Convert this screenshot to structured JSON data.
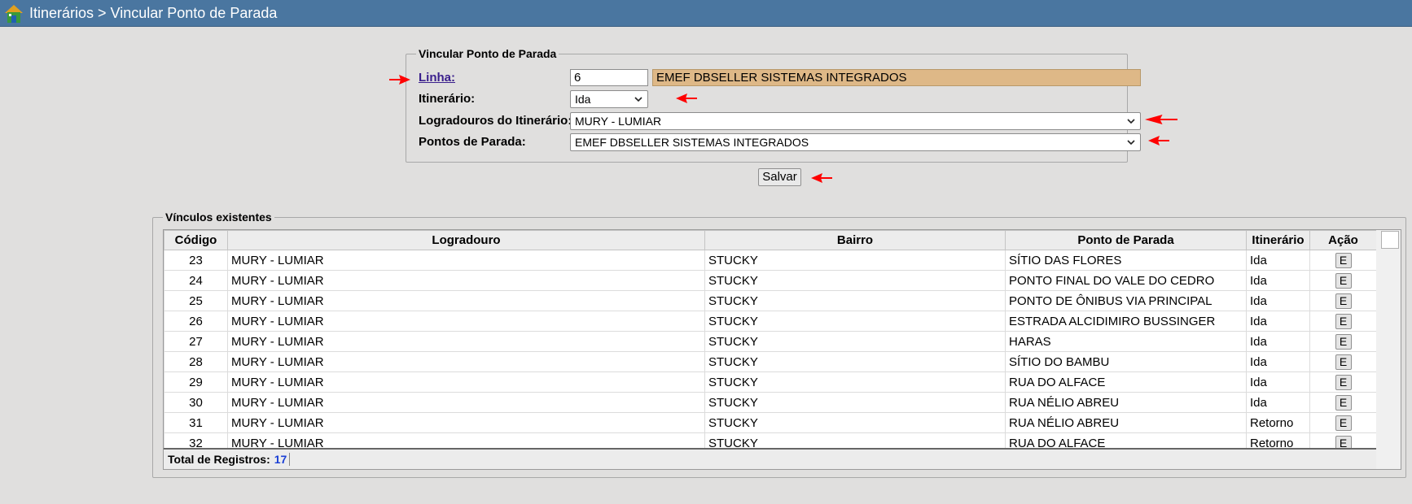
{
  "header": {
    "breadcrumb": "Itinerários > Vincular Ponto de Parada"
  },
  "form": {
    "legend": "Vincular Ponto de Parada",
    "linha_label": "Linha:",
    "linha_value": "6",
    "linha_description": "EMEF DBSELLER SISTEMAS INTEGRADOS",
    "itinerario_label": "Itinerário:",
    "itinerario_value": "Ida",
    "logradouros_label": "Logradouros do Itinerário:",
    "logradouros_value": "MURY - LUMIAR",
    "pontos_label": "Pontos de Parada:",
    "pontos_value": "EMEF DBSELLER SISTEMAS INTEGRADOS",
    "save_label": "Salvar"
  },
  "links": {
    "legend": "Vínculos existentes",
    "columns": [
      "Código",
      "Logradouro",
      "Bairro",
      "Ponto de Parada",
      "Itinerário",
      "Ação"
    ],
    "rows": [
      {
        "codigo": "23",
        "logradouro": "MURY - LUMIAR",
        "bairro": "STUCKY",
        "ponto": "SÍTIO DAS FLORES",
        "itinerario": "Ida",
        "acao": "E"
      },
      {
        "codigo": "24",
        "logradouro": "MURY - LUMIAR",
        "bairro": "STUCKY",
        "ponto": "PONTO FINAL DO VALE DO CEDRO",
        "itinerario": "Ida",
        "acao": "E"
      },
      {
        "codigo": "25",
        "logradouro": "MURY - LUMIAR",
        "bairro": "STUCKY",
        "ponto": "PONTO DE ÔNIBUS VIA PRINCIPAL",
        "itinerario": "Ida",
        "acao": "E"
      },
      {
        "codigo": "26",
        "logradouro": "MURY - LUMIAR",
        "bairro": "STUCKY",
        "ponto": "ESTRADA ALCIDIMIRO BUSSINGER",
        "itinerario": "Ida",
        "acao": "E"
      },
      {
        "codigo": "27",
        "logradouro": "MURY - LUMIAR",
        "bairro": "STUCKY",
        "ponto": "HARAS",
        "itinerario": "Ida",
        "acao": "E"
      },
      {
        "codigo": "28",
        "logradouro": "MURY - LUMIAR",
        "bairro": "STUCKY",
        "ponto": "SÍTIO DO BAMBU",
        "itinerario": "Ida",
        "acao": "E"
      },
      {
        "codigo": "29",
        "logradouro": "MURY - LUMIAR",
        "bairro": "STUCKY",
        "ponto": "RUA DO ALFACE",
        "itinerario": "Ida",
        "acao": "E"
      },
      {
        "codigo": "30",
        "logradouro": "MURY - LUMIAR",
        "bairro": "STUCKY",
        "ponto": "RUA NÉLIO ABREU",
        "itinerario": "Ida",
        "acao": "E"
      },
      {
        "codigo": "31",
        "logradouro": "MURY - LUMIAR",
        "bairro": "STUCKY",
        "ponto": "RUA NÉLIO ABREU",
        "itinerario": "Retorno",
        "acao": "E"
      },
      {
        "codigo": "32",
        "logradouro": "MURY - LUMIAR",
        "bairro": "STUCKY",
        "ponto": "RUA DO ALFACE",
        "itinerario": "Retorno",
        "acao": "E"
      }
    ],
    "total_label": "Total de Registros:",
    "total_value": "17"
  },
  "colors": {
    "titlebar": "#4a76a0",
    "readonly_field": "#deb887",
    "annotation_arrow": "#ff0000",
    "total_count": "#1a3fd6"
  },
  "icons": {
    "app": "home-icon",
    "annotation": "red-arrow-icon",
    "dropdown": "chevron-down-icon"
  }
}
